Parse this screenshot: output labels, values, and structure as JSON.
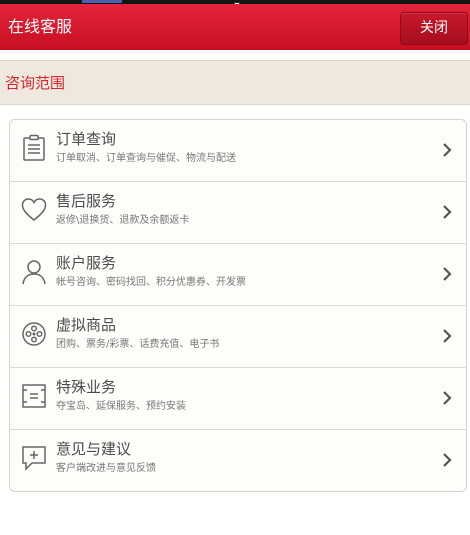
{
  "header": {
    "title": "在线客服",
    "close_label": "关闭"
  },
  "section": {
    "label": "咨询范围"
  },
  "items": [
    {
      "title": "订单查询",
      "subtitle": "订单取消、订单查询与催促、物流与配送",
      "icon": "clipboard-icon"
    },
    {
      "title": "售后服务",
      "subtitle": "返修\\退换货、退款及余额返卡",
      "icon": "heart-icon"
    },
    {
      "title": "账户服务",
      "subtitle": "帐号咨询、密码找回、积分优惠券、开发票",
      "icon": "user-icon"
    },
    {
      "title": "虚拟商品",
      "subtitle": "团购、票务/彩票、话费充值、电子书",
      "icon": "film-reel-icon"
    },
    {
      "title": "特殊业务",
      "subtitle": "夺宝岛、延保服务、预约安装",
      "icon": "ticket-icon"
    },
    {
      "title": "意见与建议",
      "subtitle": "客户端改进与意见反馈",
      "icon": "feedback-icon"
    }
  ],
  "colors": {
    "header_red": "#d5182c",
    "section_bg": "#efe8de",
    "section_label": "#d8262f",
    "icon_gray": "#666666"
  }
}
